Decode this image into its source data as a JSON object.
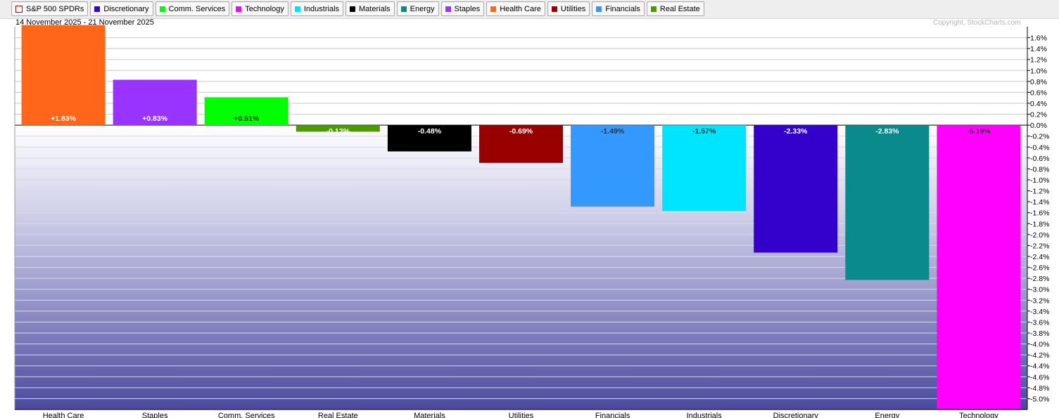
{
  "legend": [
    {
      "label": "S&P 500 SPDRs",
      "color": "#ffffff",
      "outline": true
    },
    {
      "label": "Discretionary",
      "color": "#3300cc"
    },
    {
      "label": "Comm. Services",
      "color": "#00ff00"
    },
    {
      "label": "Technology",
      "color": "#ff00ff"
    },
    {
      "label": "Industrials",
      "color": "#00e5ff"
    },
    {
      "label": "Materials",
      "color": "#000000"
    },
    {
      "label": "Energy",
      "color": "#0a8a8a"
    },
    {
      "label": "Staples",
      "color": "#9933ff"
    },
    {
      "label": "Health Care",
      "color": "#ff6619"
    },
    {
      "label": "Utilities",
      "color": "#990000"
    },
    {
      "label": "Financials",
      "color": "#3399ff"
    },
    {
      "label": "Real Estate",
      "color": "#4d9900"
    }
  ],
  "header": {
    "date_range": "14 November 2025 - 21 November 2025",
    "copyright": "Copyright, StockCharts.com"
  },
  "chart_data": {
    "type": "bar",
    "title": "",
    "xlabel": "",
    "ylabel": "",
    "categories": [
      "Health Care",
      "Staples",
      "Comm. Services",
      "Real Estate",
      "Materials",
      "Utilities",
      "Financials",
      "Industrials",
      "Discretionary",
      "Energy",
      "Technology"
    ],
    "values": [
      1.83,
      0.83,
      0.51,
      -0.12,
      -0.48,
      -0.69,
      -1.49,
      -1.57,
      -2.33,
      -2.83,
      -5.19
    ],
    "value_labels": [
      "+1.83%",
      "+0.83%",
      "+0.51%",
      "-0.12%",
      "-0.48%",
      "-0.69%",
      "-1.49%",
      "-1.57%",
      "-2.33%",
      "-2.83%",
      "-5.19%"
    ],
    "colors": [
      "#ff6619",
      "#9933ff",
      "#00ff00",
      "#4d9900",
      "#000000",
      "#990000",
      "#3399ff",
      "#00e5ff",
      "#3300cc",
      "#0a8a8a",
      "#ff00ff"
    ],
    "label_colors": [
      "#ffffff",
      "#ffffff",
      "#333333",
      "#ffffff",
      "#ffffff",
      "#ffffff",
      "#333333",
      "#333333",
      "#ffffff",
      "#ffffff",
      "#333333"
    ],
    "ylim": [
      -5.2,
      1.8
    ],
    "y_axis_side": "right",
    "ytick_values": [
      1.6,
      1.4,
      1.2,
      1.0,
      0.8,
      0.6,
      0.4,
      0.2,
      0.0,
      -0.2,
      -0.4,
      -0.6,
      -0.8,
      -1.0,
      -1.2,
      -1.4,
      -1.6,
      -1.8,
      -2.0,
      -2.2,
      -2.4,
      -2.6,
      -2.8,
      -3.0,
      -3.2,
      -3.4,
      -3.6,
      -3.8,
      -4.0,
      -4.2,
      -4.4,
      -4.6,
      -4.8,
      -5.0
    ],
    "ytick_labels": [
      "1.6%",
      "1.4%",
      "1.2%",
      "1.0%",
      "0.8%",
      "0.6%",
      "0.4%",
      "0.2%",
      "0.0%",
      "-0.2%",
      "-0.4%",
      "-0.6%",
      "-0.8%",
      "-1.0%",
      "-1.2%",
      "-1.4%",
      "-1.6%",
      "-1.8%",
      "-2.0%",
      "-2.2%",
      "-2.4%",
      "-2.6%",
      "-2.8%",
      "-3.0%",
      "-3.2%",
      "-3.4%",
      "-3.6%",
      "-3.8%",
      "-4.0%",
      "-4.2%",
      "-4.4%",
      "-4.6%",
      "-4.8%",
      "-5.0%"
    ],
    "grid": true,
    "negative_background": "gradient white-to-blue"
  }
}
